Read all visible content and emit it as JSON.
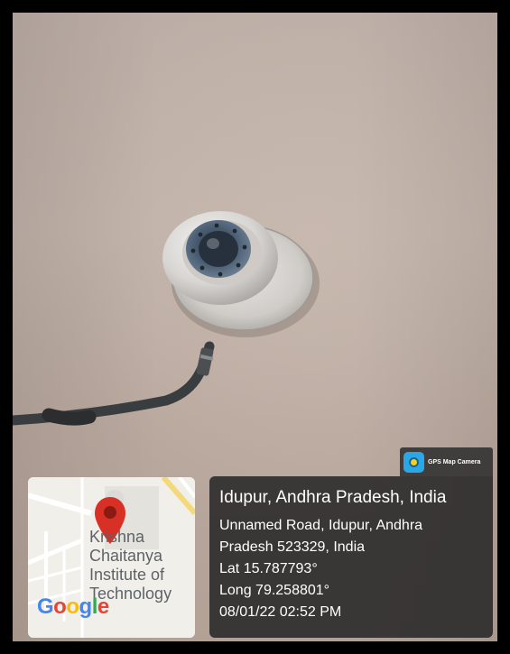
{
  "photo": {
    "subject": "dome-cctv-camera",
    "wall_color": "#bcaea6"
  },
  "map": {
    "place_lines": [
      "Krishna",
      "Chaitanya",
      "Institute of",
      "Technology"
    ],
    "provider": "Google",
    "pin_color": "#d93025"
  },
  "app": {
    "name": "GPS Map Camera",
    "icon": "gps-map-camera-icon"
  },
  "location": {
    "title": "Idupur, Andhra Pradesh, India",
    "address_line1": "Unnamed Road, Idupur, Andhra",
    "address_line2": "Pradesh 523329, India",
    "latitude": "Lat 15.787793°",
    "longitude": "Long 79.258801°",
    "datetime": "08/01/22 02:52 PM"
  }
}
